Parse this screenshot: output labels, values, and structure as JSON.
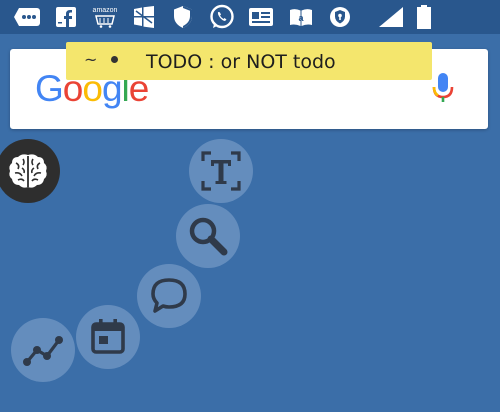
{
  "status_bar": {
    "icons": [
      {
        "name": "message-icon"
      },
      {
        "name": "facebook-icon"
      },
      {
        "name": "amazon-icon",
        "text": "amazon"
      },
      {
        "name": "windows-icon"
      },
      {
        "name": "shield-icon"
      },
      {
        "name": "whatsapp-icon"
      },
      {
        "name": "id-card-icon"
      },
      {
        "name": "kindle-icon"
      },
      {
        "name": "vpn-icon"
      },
      {
        "name": "signal-icon"
      },
      {
        "name": "battery-icon"
      }
    ]
  },
  "google_bar": {
    "logo_letters": [
      "G",
      "o",
      "o",
      "g",
      "l",
      "e"
    ],
    "logo_colors": [
      "#4285F4",
      "#EA4335",
      "#FBBC05",
      "#4285F4",
      "#34A853",
      "#EA4335"
    ]
  },
  "todo_note": {
    "prefix": "~",
    "text": "TODO : or NOT todo"
  },
  "floating_buttons": [
    {
      "name": "brain-button",
      "icon": "brain-icon"
    },
    {
      "name": "text-recognition-button",
      "icon": "text-scan-icon"
    },
    {
      "name": "search-button",
      "icon": "magnifier-icon"
    },
    {
      "name": "chat-button",
      "icon": "chat-bubble-icon"
    },
    {
      "name": "calendar-button",
      "icon": "calendar-icon"
    },
    {
      "name": "graph-button",
      "icon": "line-graph-icon"
    }
  ],
  "colors": {
    "background": "#3b6ea8",
    "status_bar": "#29578d",
    "note_yellow": "#f4e66d",
    "icon_dark": "#2f3a4a"
  }
}
